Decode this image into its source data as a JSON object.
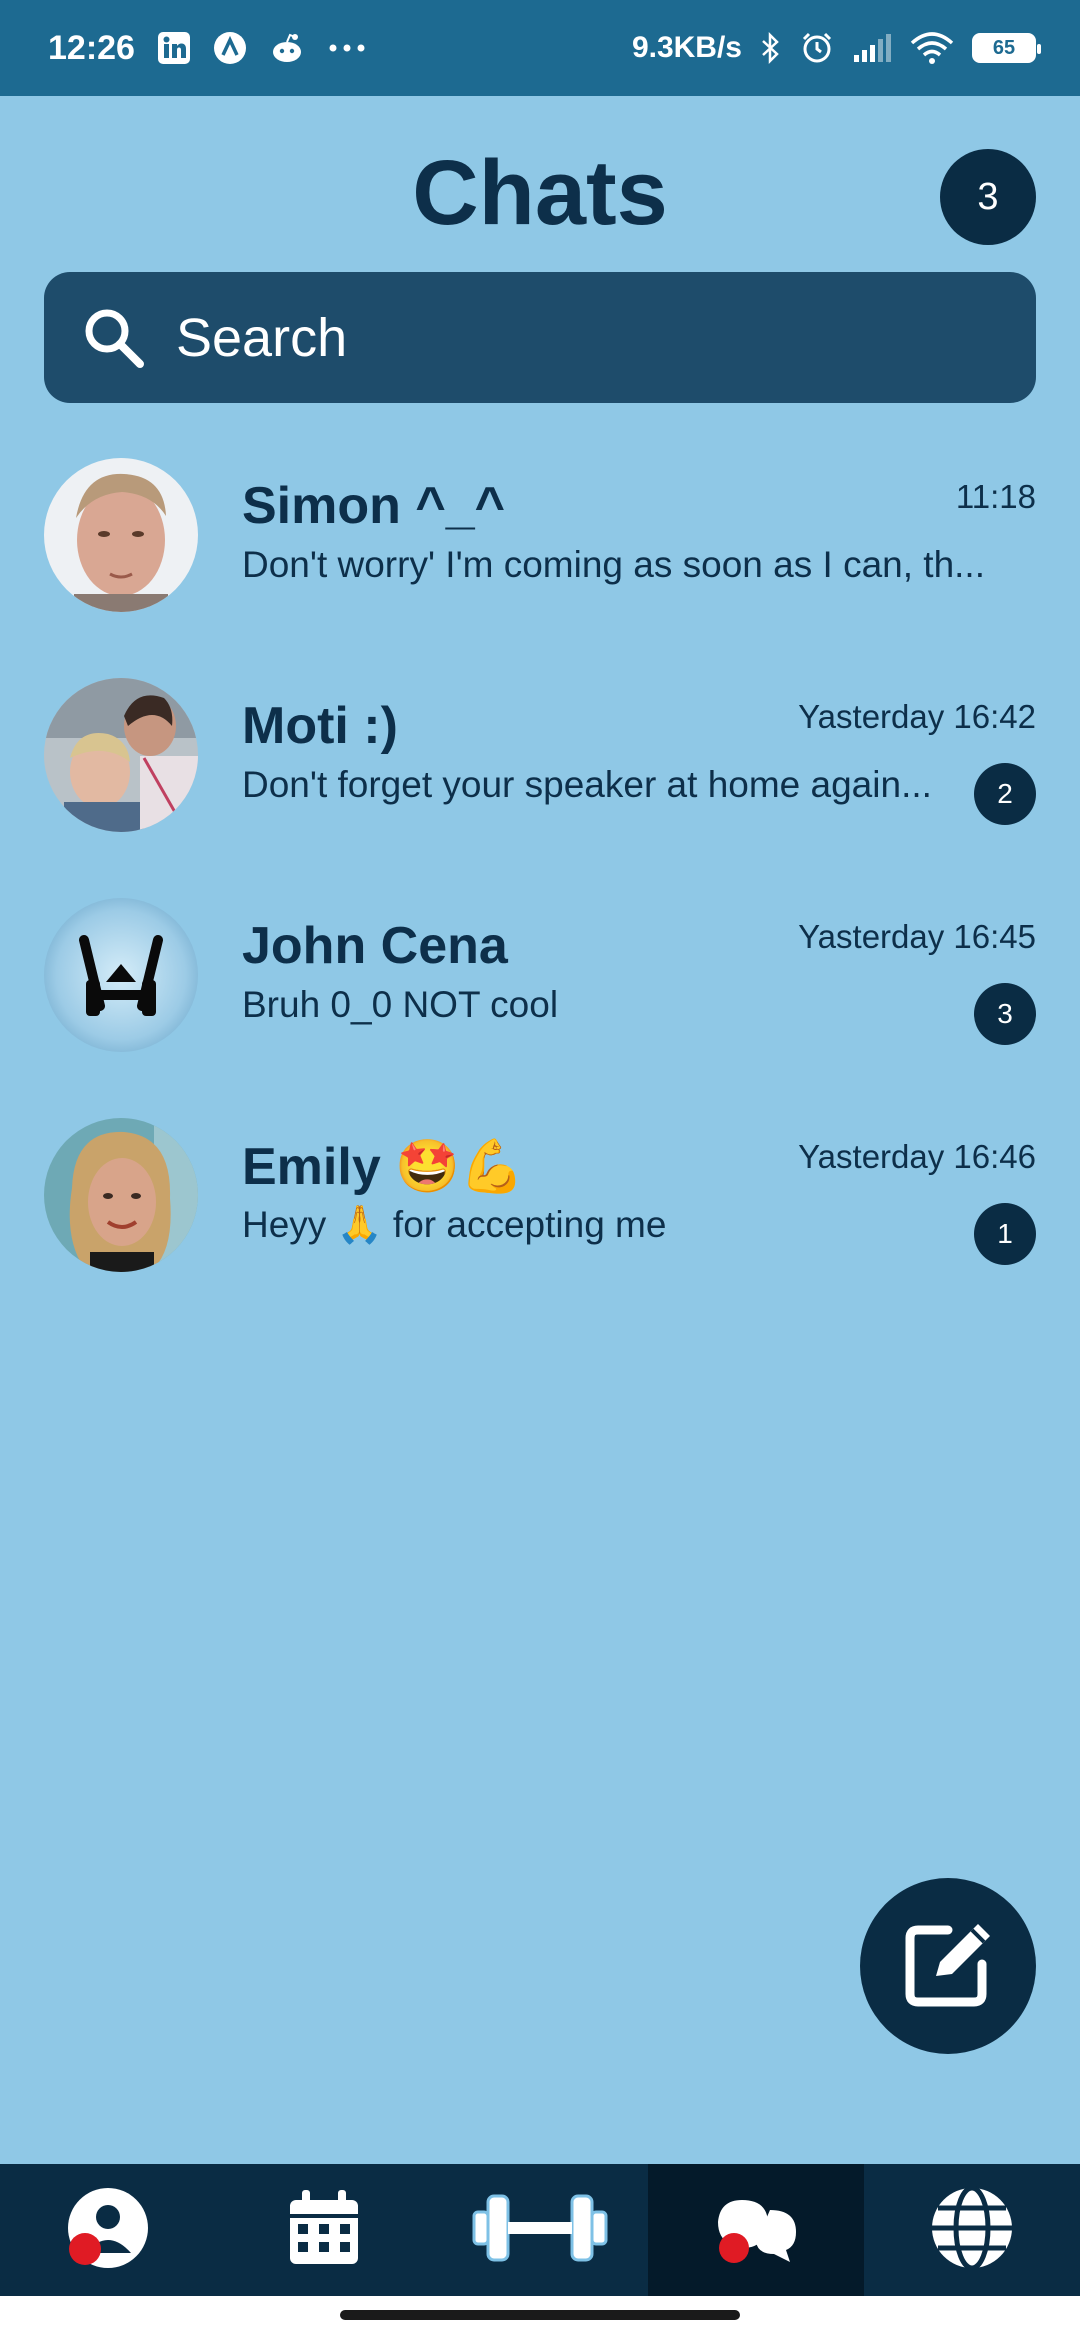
{
  "status_bar": {
    "time": "12:26",
    "net_speed": "9.3KB/s",
    "battery": "65",
    "left_icons": [
      "linkedin-icon",
      "app-icon",
      "reddit-icon",
      "more-dots-icon"
    ],
    "right_icons": [
      "bluetooth-icon",
      "alarm-icon",
      "signal-icon",
      "wifi-icon",
      "battery-icon"
    ]
  },
  "header": {
    "title": "Chats",
    "count_badge": "3"
  },
  "search": {
    "placeholder": "Search"
  },
  "chats": [
    {
      "name": "Simon ^_^",
      "time": "11:18",
      "preview": "Don't worry' I'm coming as soon as I can, th...",
      "unread": ""
    },
    {
      "name": "Moti :)",
      "time": "Yasterday 16:42",
      "preview": "Don't forget your speaker at home again...",
      "unread": "2"
    },
    {
      "name": "John Cena",
      "time": "Yasterday 16:45",
      "preview": "Bruh  0_0 NOT cool",
      "unread": "3"
    },
    {
      "name": "Emily 🤩💪",
      "time": "Yasterday 16:46",
      "preview": "Heyy 🙏  for accepting me",
      "unread": "1"
    }
  ],
  "fab": {
    "icon": "edit-icon"
  },
  "bottom_nav": {
    "items": [
      "profile-icon",
      "calendar-icon",
      "dumbbell-icon",
      "chat-bubbles-icon",
      "globe-icon"
    ],
    "active_index": 3
  },
  "colors": {
    "background": "#8fc8e6",
    "status_bar": "#1d6a91",
    "dark_navy": "#0a2c44",
    "search_bg": "#1e4c6b",
    "accent_red": "#e01b24"
  }
}
